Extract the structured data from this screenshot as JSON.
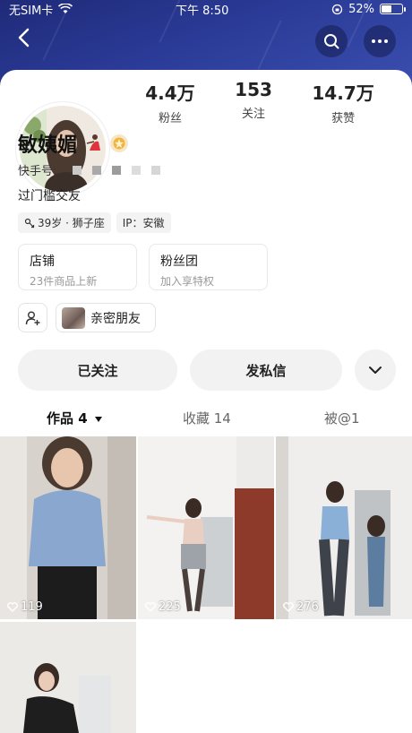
{
  "status_bar": {
    "carrier": "无SIM卡",
    "time": "下午 8:50",
    "battery": "52%",
    "battery_level": 0.52
  },
  "profile": {
    "name": "敏姨媚",
    "id_label": "快手号:",
    "bio": "过门槛交友",
    "tag_age": "39岁 · 狮子座",
    "tag_ip": "IP：安徽"
  },
  "stats": [
    {
      "value": "4.4万",
      "label": "粉丝"
    },
    {
      "value": "153",
      "label": "关注"
    },
    {
      "value": "14.7万",
      "label": "获赞"
    }
  ],
  "cards": [
    {
      "title": "店铺",
      "subtitle": "23件商品上新"
    },
    {
      "title": "粉丝团",
      "subtitle": "加入享特权"
    }
  ],
  "close_friends": "亲密朋友",
  "actions": {
    "followed": "已关注",
    "message": "发私信"
  },
  "tabs": [
    {
      "label": "作品 4"
    },
    {
      "label": "收藏 14"
    },
    {
      "label": "被@1"
    }
  ],
  "videos": [
    {
      "likes": "119"
    },
    {
      "likes": "225"
    },
    {
      "likes": "276"
    },
    {
      "likes": ""
    }
  ],
  "icons": {
    "back": "back-arrow-icon",
    "search": "search-icon",
    "more": "more-dots-icon"
  }
}
